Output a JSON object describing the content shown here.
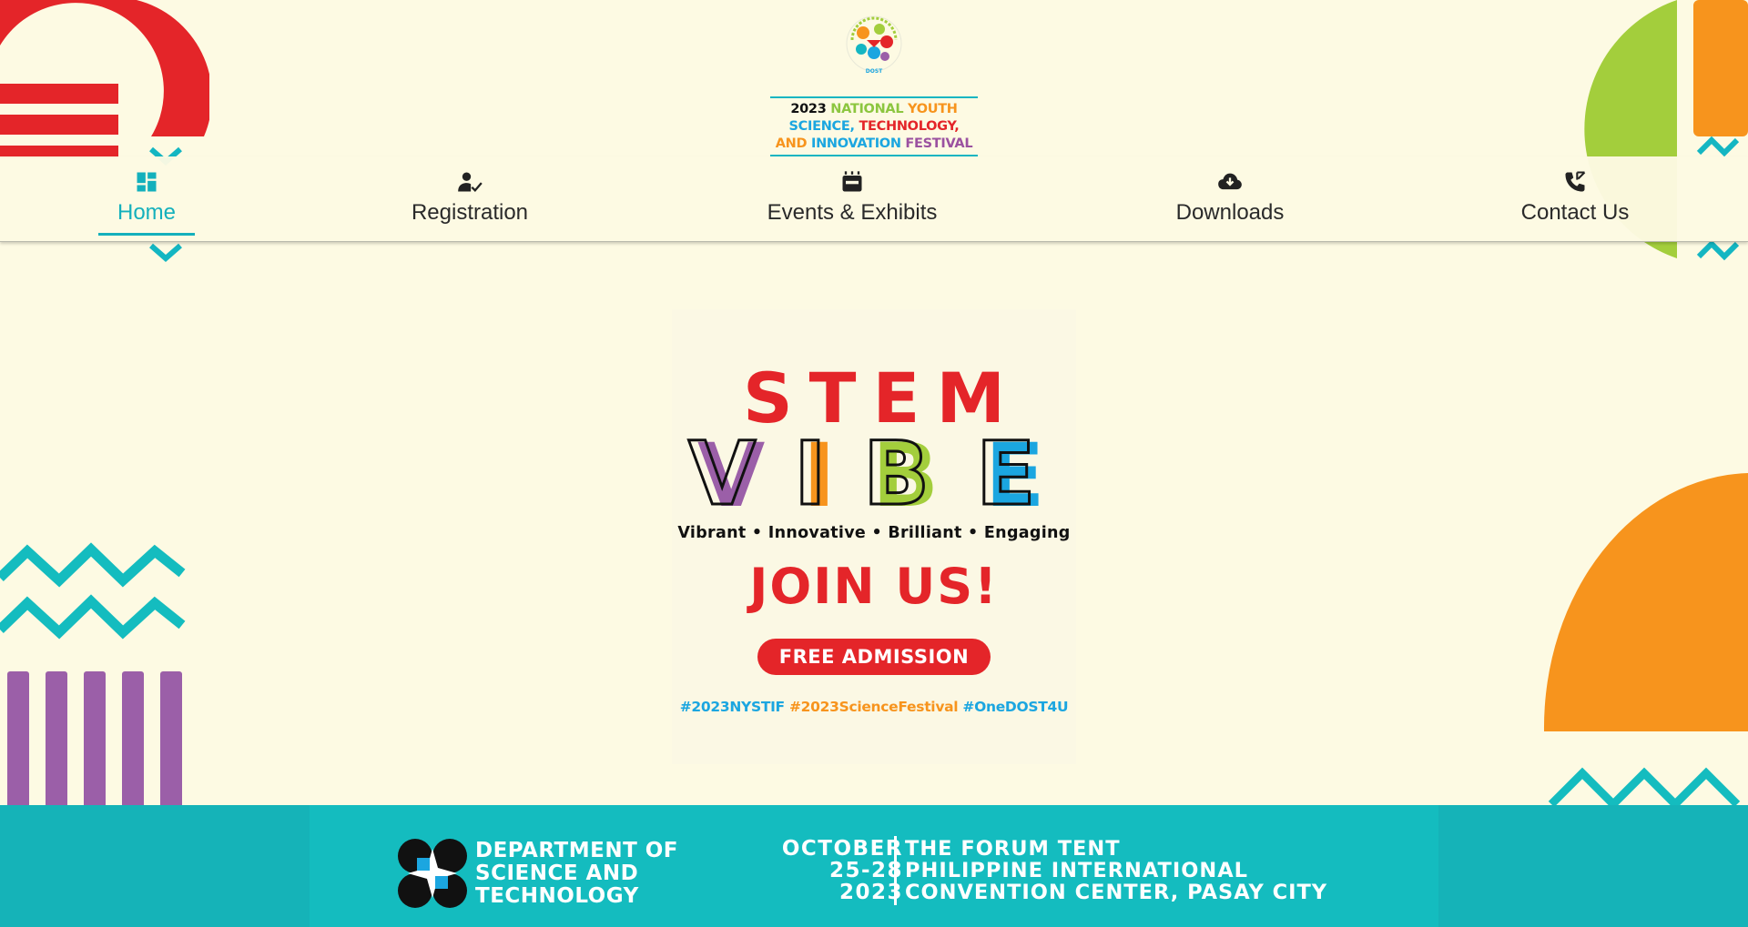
{
  "logo": {
    "text_line1": [
      {
        "text": "2023 ",
        "color": "#111111"
      },
      {
        "text": "NATIONAL ",
        "color": "#8cc63f"
      },
      {
        "text": "YOUTH",
        "color": "#f7941d"
      }
    ],
    "text_line2": [
      {
        "text": "SCIENCE, ",
        "color": "#1ba6e0"
      },
      {
        "text": "TECHNOLOGY,",
        "color": "#e42529"
      }
    ],
    "text_line3": [
      {
        "text": "AND ",
        "color": "#f7941d"
      },
      {
        "text": "INNOVATION ",
        "color": "#1ba6e0"
      },
      {
        "text": "FESTIVAL",
        "color": "#9b51a0"
      }
    ],
    "emblem_label": "DOST"
  },
  "nav": {
    "items": [
      {
        "label": "Home",
        "icon": "dashboard-icon",
        "active": true
      },
      {
        "label": "Registration",
        "icon": "user-check-icon",
        "active": false
      },
      {
        "label": "Events & Exhibits",
        "icon": "theater-icon",
        "active": false
      },
      {
        "label": "Downloads",
        "icon": "cloud-download-icon",
        "active": false
      },
      {
        "label": "Contact Us",
        "icon": "phone-icon",
        "active": false
      }
    ]
  },
  "poster": {
    "stem": "STEM",
    "vibe_letters": [
      "V",
      "I",
      "B",
      "E"
    ],
    "tagline": "Vibrant • Innovative • Brilliant • Engaging",
    "join": "JOIN US!",
    "admission_button": "FREE ADMISSION",
    "hashtags": [
      {
        "text": "#2023NYSTIF ",
        "color": "#1ba6e0"
      },
      {
        "text": "#2023ScienceFestival ",
        "color": "#f7941d"
      },
      {
        "text": "#OneDOST4U",
        "color": "#1ba6e0"
      }
    ]
  },
  "footer": {
    "org_lines": [
      "DEPARTMENT OF",
      "SCIENCE AND",
      "TECHNOLOGY"
    ],
    "date_lines": [
      "OCTOBER",
      "25-28",
      "2023"
    ],
    "venue_lines": [
      "THE FORUM TENT",
      "PHILIPPINE INTERNATIONAL",
      "CONVENTION CENTER, PASAY CITY"
    ]
  },
  "colors": {
    "background": "#fdfae3",
    "teal": "#14b6c2",
    "red": "#e42529",
    "orange": "#f7941d",
    "green": "#a3ce3c",
    "purple": "#9b5fa8",
    "blue": "#1ba6e0"
  }
}
